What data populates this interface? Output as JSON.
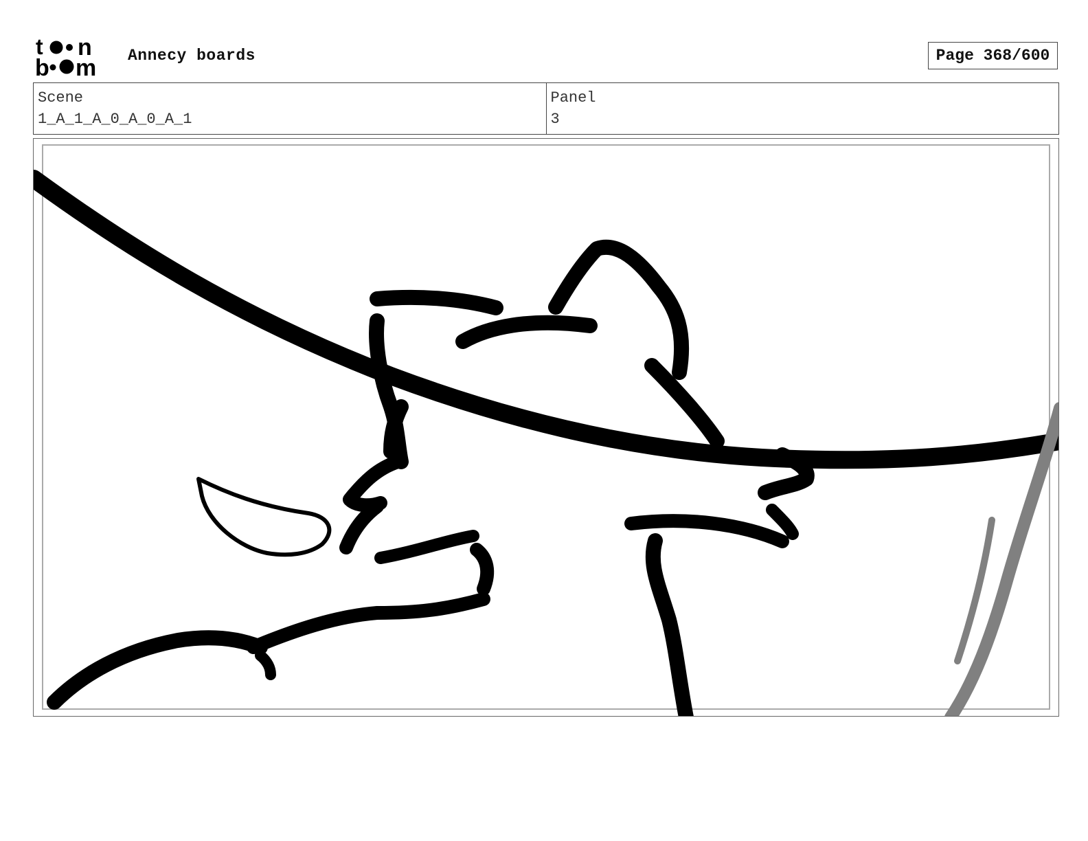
{
  "header": {
    "logo_icon": "toonboom-logo-icon",
    "logo_text": "toon boom",
    "title": "Annecy boards",
    "page": "Page 368/600"
  },
  "info": {
    "scene_label": "Scene",
    "scene_value": "1_A_1_A_0_A_0_A_1",
    "panel_label": "Panel",
    "panel_value": "3"
  },
  "panel": {
    "drawing_icon": "storyboard-sketch-image"
  },
  "colors": {
    "ink": "#000000",
    "pencil_gray": "#808080",
    "frame": "#666666"
  }
}
